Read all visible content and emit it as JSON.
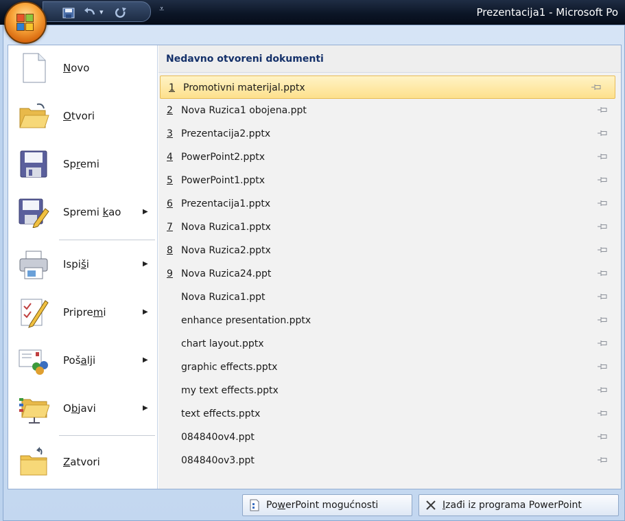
{
  "window": {
    "title": "Prezentacija1 - Microsoft Po",
    "quick_access": {
      "undo_dropdown": "▾",
      "customize": "⩡"
    }
  },
  "menu": {
    "commands": [
      {
        "id": "novo",
        "pre": "",
        "acc": "N",
        "post": "ovo",
        "submenu": false,
        "icon": "new-document-icon"
      },
      {
        "id": "otvori",
        "pre": "",
        "acc": "O",
        "post": "tvori",
        "submenu": false,
        "icon": "open-folder-icon"
      },
      {
        "id": "spremi",
        "pre": "Sp",
        "acc": "r",
        "post": "emi",
        "submenu": false,
        "icon": "save-icon"
      },
      {
        "id": "spremi-kao",
        "pre": "Spremi ",
        "acc": "k",
        "post": "ao",
        "submenu": true,
        "icon": "save-as-icon"
      },
      {
        "id": "ispisi",
        "pre": "Ispi",
        "acc": "š",
        "post": "i",
        "submenu": true,
        "icon": "print-icon"
      },
      {
        "id": "pripremi",
        "pre": "Pripre",
        "acc": "m",
        "post": "i",
        "submenu": true,
        "icon": "prepare-icon"
      },
      {
        "id": "posalji",
        "pre": "Poš",
        "acc": "a",
        "post": "lji",
        "submenu": true,
        "icon": "send-icon"
      },
      {
        "id": "objavi",
        "pre": "O",
        "acc": "b",
        "post": "javi",
        "submenu": true,
        "icon": "publish-icon"
      },
      {
        "id": "zatvori",
        "pre": "",
        "acc": "Z",
        "post": "atvori",
        "submenu": false,
        "icon": "close-folder-icon"
      }
    ],
    "submenu_arrow": "▶"
  },
  "recent": {
    "heading": "Nedavno otvoreni dokumenti",
    "items": [
      {
        "num": "1",
        "name": "Promotivni materijal.pptx"
      },
      {
        "num": "2",
        "name": "Nova Ruzica1 obojena.ppt"
      },
      {
        "num": "3",
        "name": "Prezentacija2.pptx"
      },
      {
        "num": "4",
        "name": "PowerPoint2.pptx"
      },
      {
        "num": "5",
        "name": "PowerPoint1.pptx"
      },
      {
        "num": "6",
        "name": "Prezentacija1.pptx"
      },
      {
        "num": "7",
        "name": "Nova Ruzica1.pptx"
      },
      {
        "num": "8",
        "name": "Nova Ruzica2.pptx"
      },
      {
        "num": "9",
        "name": "Nova Ruzica24.ppt"
      },
      {
        "num": "",
        "name": "Nova Ruzica1.ppt"
      },
      {
        "num": "",
        "name": "enhance presentation.pptx"
      },
      {
        "num": "",
        "name": "chart layout.pptx"
      },
      {
        "num": "",
        "name": "graphic effects.pptx"
      },
      {
        "num": "",
        "name": "my text effects.pptx"
      },
      {
        "num": "",
        "name": "text effects.pptx"
      },
      {
        "num": "",
        "name": "084840ov4.ppt"
      },
      {
        "num": "",
        "name": "084840ov3.ppt"
      }
    ]
  },
  "footer": {
    "options": {
      "pre": "Po",
      "acc": "w",
      "post": "erPoint mogućnosti"
    },
    "exit": {
      "pre": "",
      "acc": "I",
      "post": "zađi iz programa PowerPoint"
    }
  },
  "colors": {
    "highlight": "#fde08c",
    "heading": "#15316a",
    "office_orange": "#f8a53a"
  }
}
